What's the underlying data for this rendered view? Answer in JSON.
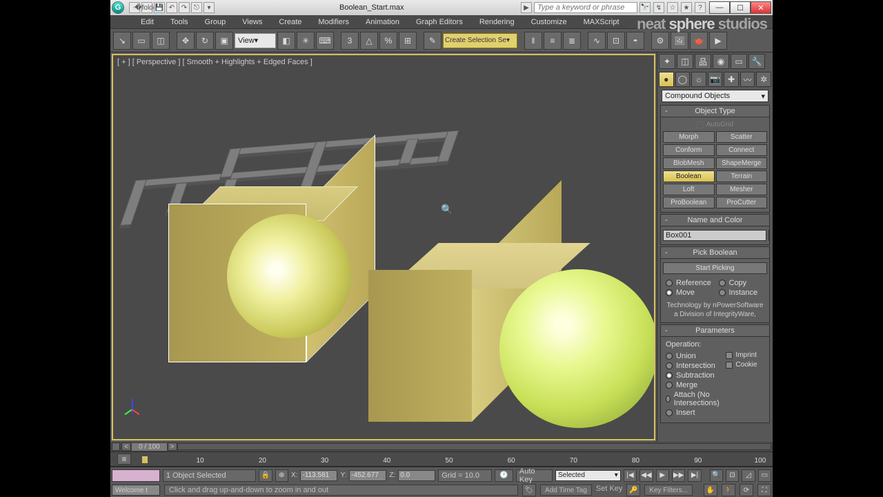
{
  "title": {
    "filename": "Boolean_Start.max",
    "search_placeholder": "Type a keyword or phrase"
  },
  "menu": [
    "Edit",
    "Tools",
    "Group",
    "Views",
    "Create",
    "Modifiers",
    "Animation",
    "Graph Editors",
    "Rendering",
    "Customize",
    "MAXScript"
  ],
  "toolbar": {
    "ref_coord": "View",
    "named_sel": "Create Selection Se"
  },
  "viewport": {
    "label": "[ + ] [ Perspective ] [ Smooth + Highlights + Edged Faces ]"
  },
  "timeline": {
    "label": "0 / 100",
    "ticks": [
      10,
      20,
      30,
      40,
      50,
      60,
      70,
      80,
      90,
      100
    ]
  },
  "status": {
    "selection": "1 Object Selected",
    "x": "-113.581",
    "y": "-452.677",
    "z": "0.0",
    "grid": "Grid = 10.0",
    "autokey": "Auto Key",
    "setkey": "Set Key",
    "sel_filter": "Selected",
    "keyfilters": "Key Filters..."
  },
  "hint": {
    "welcome": "Welcome t",
    "msg": "Click and drag up-and-down to zoom in and out",
    "timetag": "Add Time Tag"
  },
  "panel": {
    "category": "Compound Objects",
    "objtype_head": "Object Type",
    "autogrid": "AutoGrid",
    "buttons": [
      [
        "Morph",
        "Scatter"
      ],
      [
        "Conform",
        "Connect"
      ],
      [
        "BlobMesh",
        "ShapeMerge"
      ],
      [
        "Boolean",
        "Terrain"
      ],
      [
        "Loft",
        "Mesher"
      ],
      [
        "ProBoolean",
        "ProCutter"
      ]
    ],
    "active_button": "Boolean",
    "name_head": "Name and Color",
    "name_value": "Box001",
    "pick_head": "Pick Boolean",
    "start_picking": "Start Picking",
    "pick_opts": {
      "reference": "Reference",
      "copy": "Copy",
      "move": "Move",
      "instance": "Instance",
      "checked": "move"
    },
    "credit1": "Technology by nPowerSoftware",
    "credit2": "a Division of IntegrityWare,",
    "params_head": "Parameters",
    "op_label": "Operation:",
    "ops": [
      "Union",
      "Intersection",
      "Subtraction",
      "Merge",
      "Attach (No Intersections)",
      "Insert"
    ],
    "op_checked": "Subtraction",
    "imprint": "Imprint",
    "cookie": "Cookie"
  },
  "watermark": {
    "a": "neat",
    "b": " sphere ",
    "c": "studios"
  }
}
